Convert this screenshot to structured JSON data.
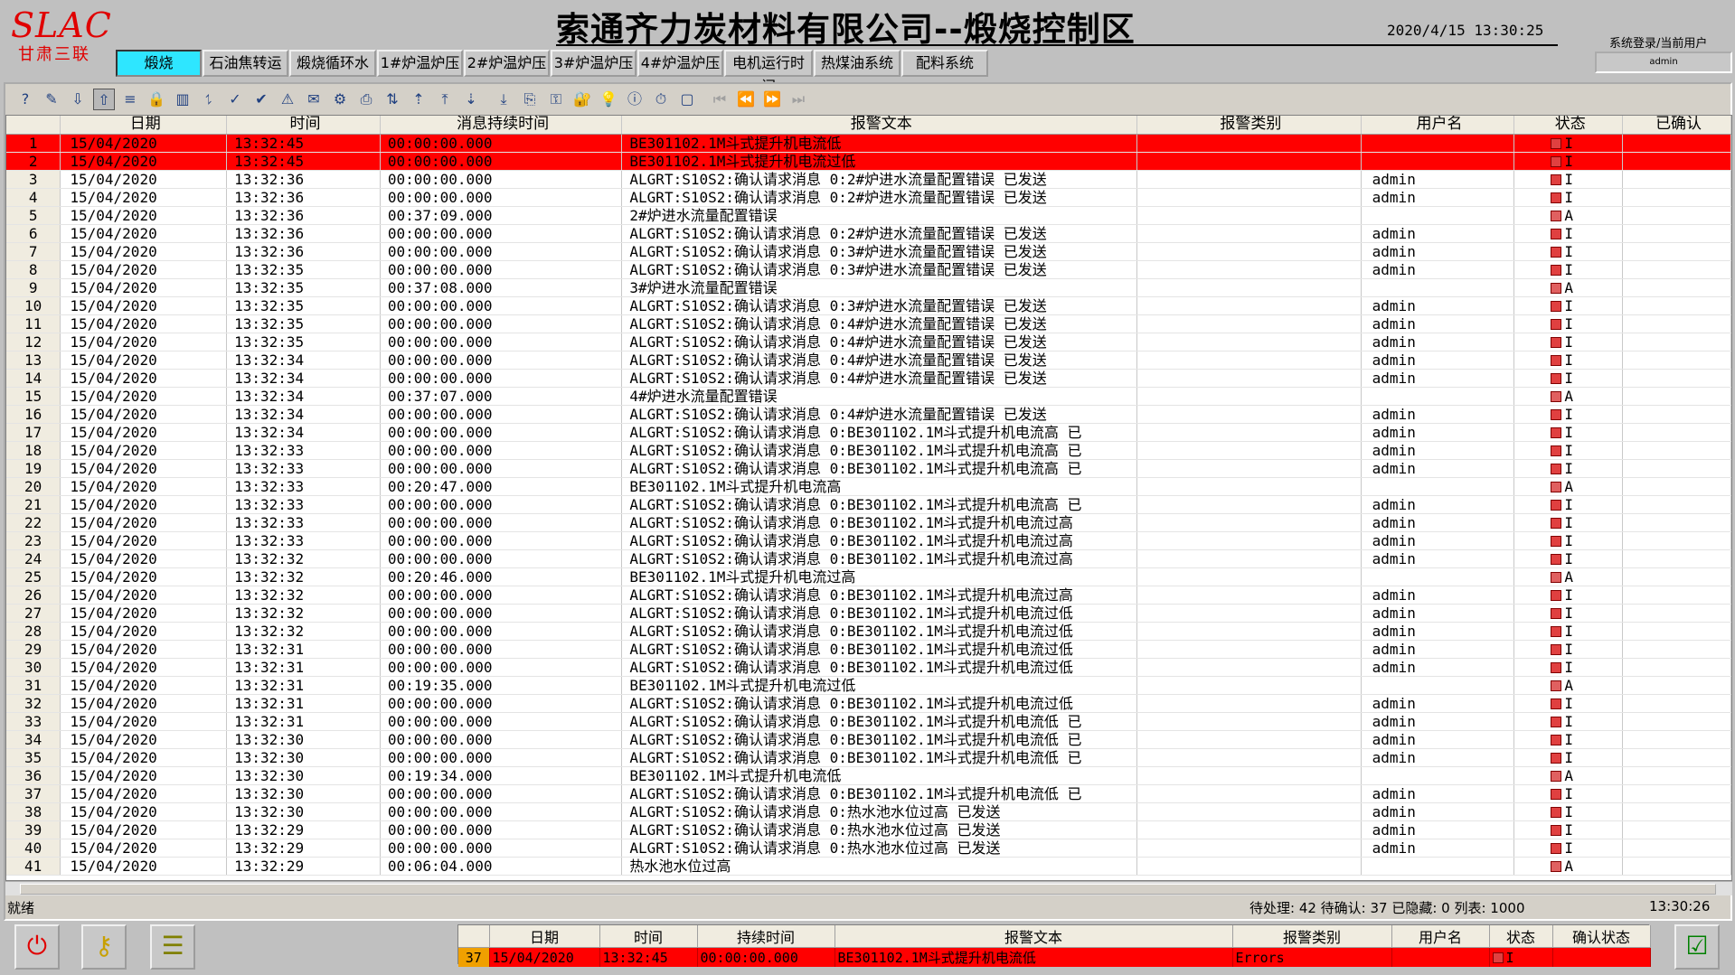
{
  "header": {
    "logo": "SLAC",
    "logo_sub": "甘肃三联",
    "title": "索通齐力炭材料有限公司--煅烧控制区",
    "datetime": "2020/4/15 13:30:25",
    "login_label": "系统登录/当前用户",
    "login_user": "admin"
  },
  "nav": {
    "tabs": [
      "煅烧",
      "石油焦转运",
      "煅烧循环水",
      "1#炉温炉压",
      "2#炉温炉压",
      "3#炉温炉压",
      "4#炉温炉压",
      "电机运行时间",
      "热煤油系统",
      "配料系统"
    ],
    "active": "煅烧"
  },
  "toolbar": {
    "icons": [
      "help-icon",
      "edit-icon",
      "export-icon",
      "import-icon",
      "list-icon",
      "lock-icon",
      "chart-icon",
      "filter-icon",
      "ack-icon",
      "check-icon",
      "alarm-icon",
      "note-icon",
      "settings-icon",
      "print-icon",
      "sort-icon",
      "up-icon",
      "first-icon",
      "down-icon",
      "last-icon",
      "copy-icon",
      "key-icon",
      "padlock-icon",
      "bulb-icon",
      "info-icon",
      "clock-icon",
      "window-icon",
      "nav-first-icon",
      "nav-prev-icon",
      "nav-next-icon",
      "nav-last-icon"
    ]
  },
  "grid": {
    "columns": [
      "",
      "日期",
      "时间",
      "消息持续时间",
      "报警文本",
      "报警类别",
      "用户名",
      "状态",
      "已确认"
    ],
    "rows": [
      {
        "n": "1",
        "d": "15/04/2020",
        "t": "13:32:45",
        "dur": "00:00:00.000",
        "text": "BE301102.1M斗式提升机电流低",
        "cat": "",
        "user": "",
        "st": "I",
        "red": true
      },
      {
        "n": "2",
        "d": "15/04/2020",
        "t": "13:32:45",
        "dur": "00:00:00.000",
        "text": "BE301102.1M斗式提升机电流过低",
        "cat": "",
        "user": "",
        "st": "I",
        "red": true
      },
      {
        "n": "3",
        "d": "15/04/2020",
        "t": "13:32:36",
        "dur": "00:00:00.000",
        "text": "ALGRT:S10S2:确认请求消息 0:2#炉进水流量配置错误 已发送",
        "cat": "",
        "user": "admin",
        "st": "I"
      },
      {
        "n": "4",
        "d": "15/04/2020",
        "t": "13:32:36",
        "dur": "00:00:00.000",
        "text": "ALGRT:S10S2:确认请求消息 0:2#炉进水流量配置错误 已发送",
        "cat": "",
        "user": "admin",
        "st": "I"
      },
      {
        "n": "5",
        "d": "15/04/2020",
        "t": "13:32:36",
        "dur": "00:37:09.000",
        "text": "2#炉进水流量配置错误",
        "cat": "",
        "user": "",
        "st": "A"
      },
      {
        "n": "6",
        "d": "15/04/2020",
        "t": "13:32:36",
        "dur": "00:00:00.000",
        "text": "ALGRT:S10S2:确认请求消息 0:2#炉进水流量配置错误 已发送",
        "cat": "",
        "user": "admin",
        "st": "I"
      },
      {
        "n": "7",
        "d": "15/04/2020",
        "t": "13:32:36",
        "dur": "00:00:00.000",
        "text": "ALGRT:S10S2:确认请求消息 0:3#炉进水流量配置错误 已发送",
        "cat": "",
        "user": "admin",
        "st": "I"
      },
      {
        "n": "8",
        "d": "15/04/2020",
        "t": "13:32:35",
        "dur": "00:00:00.000",
        "text": "ALGRT:S10S2:确认请求消息 0:3#炉进水流量配置错误 已发送",
        "cat": "",
        "user": "admin",
        "st": "I"
      },
      {
        "n": "9",
        "d": "15/04/2020",
        "t": "13:32:35",
        "dur": "00:37:08.000",
        "text": "3#炉进水流量配置错误",
        "cat": "",
        "user": "",
        "st": "A"
      },
      {
        "n": "10",
        "d": "15/04/2020",
        "t": "13:32:35",
        "dur": "00:00:00.000",
        "text": "ALGRT:S10S2:确认请求消息 0:3#炉进水流量配置错误 已发送",
        "cat": "",
        "user": "admin",
        "st": "I"
      },
      {
        "n": "11",
        "d": "15/04/2020",
        "t": "13:32:35",
        "dur": "00:00:00.000",
        "text": "ALGRT:S10S2:确认请求消息 0:4#炉进水流量配置错误 已发送",
        "cat": "",
        "user": "admin",
        "st": "I"
      },
      {
        "n": "12",
        "d": "15/04/2020",
        "t": "13:32:35",
        "dur": "00:00:00.000",
        "text": "ALGRT:S10S2:确认请求消息 0:4#炉进水流量配置错误 已发送",
        "cat": "",
        "user": "admin",
        "st": "I"
      },
      {
        "n": "13",
        "d": "15/04/2020",
        "t": "13:32:34",
        "dur": "00:00:00.000",
        "text": "ALGRT:S10S2:确认请求消息 0:4#炉进水流量配置错误 已发送",
        "cat": "",
        "user": "admin",
        "st": "I"
      },
      {
        "n": "14",
        "d": "15/04/2020",
        "t": "13:32:34",
        "dur": "00:00:00.000",
        "text": "ALGRT:S10S2:确认请求消息 0:4#炉进水流量配置错误 已发送",
        "cat": "",
        "user": "admin",
        "st": "I"
      },
      {
        "n": "15",
        "d": "15/04/2020",
        "t": "13:32:34",
        "dur": "00:37:07.000",
        "text": "4#炉进水流量配置错误",
        "cat": "",
        "user": "",
        "st": "A"
      },
      {
        "n": "16",
        "d": "15/04/2020",
        "t": "13:32:34",
        "dur": "00:00:00.000",
        "text": "ALGRT:S10S2:确认请求消息 0:4#炉进水流量配置错误 已发送",
        "cat": "",
        "user": "admin",
        "st": "I"
      },
      {
        "n": "17",
        "d": "15/04/2020",
        "t": "13:32:34",
        "dur": "00:00:00.000",
        "text": "ALGRT:S10S2:确认请求消息 0:BE301102.1M斗式提升机电流高 已",
        "cat": "",
        "user": "admin",
        "st": "I"
      },
      {
        "n": "18",
        "d": "15/04/2020",
        "t": "13:32:33",
        "dur": "00:00:00.000",
        "text": "ALGRT:S10S2:确认请求消息 0:BE301102.1M斗式提升机电流高 已",
        "cat": "",
        "user": "admin",
        "st": "I"
      },
      {
        "n": "19",
        "d": "15/04/2020",
        "t": "13:32:33",
        "dur": "00:00:00.000",
        "text": "ALGRT:S10S2:确认请求消息 0:BE301102.1M斗式提升机电流高 已",
        "cat": "",
        "user": "admin",
        "st": "I"
      },
      {
        "n": "20",
        "d": "15/04/2020",
        "t": "13:32:33",
        "dur": "00:20:47.000",
        "text": "BE301102.1M斗式提升机电流高",
        "cat": "",
        "user": "",
        "st": "A"
      },
      {
        "n": "21",
        "d": "15/04/2020",
        "t": "13:32:33",
        "dur": "00:00:00.000",
        "text": "ALGRT:S10S2:确认请求消息 0:BE301102.1M斗式提升机电流高 已",
        "cat": "",
        "user": "admin",
        "st": "I"
      },
      {
        "n": "22",
        "d": "15/04/2020",
        "t": "13:32:33",
        "dur": "00:00:00.000",
        "text": "ALGRT:S10S2:确认请求消息 0:BE301102.1M斗式提升机电流过高",
        "cat": "",
        "user": "admin",
        "st": "I"
      },
      {
        "n": "23",
        "d": "15/04/2020",
        "t": "13:32:33",
        "dur": "00:00:00.000",
        "text": "ALGRT:S10S2:确认请求消息 0:BE301102.1M斗式提升机电流过高",
        "cat": "",
        "user": "admin",
        "st": "I"
      },
      {
        "n": "24",
        "d": "15/04/2020",
        "t": "13:32:32",
        "dur": "00:00:00.000",
        "text": "ALGRT:S10S2:确认请求消息 0:BE301102.1M斗式提升机电流过高",
        "cat": "",
        "user": "admin",
        "st": "I"
      },
      {
        "n": "25",
        "d": "15/04/2020",
        "t": "13:32:32",
        "dur": "00:20:46.000",
        "text": "BE301102.1M斗式提升机电流过高",
        "cat": "",
        "user": "",
        "st": "A"
      },
      {
        "n": "26",
        "d": "15/04/2020",
        "t": "13:32:32",
        "dur": "00:00:00.000",
        "text": "ALGRT:S10S2:确认请求消息 0:BE301102.1M斗式提升机电流过高",
        "cat": "",
        "user": "admin",
        "st": "I"
      },
      {
        "n": "27",
        "d": "15/04/2020",
        "t": "13:32:32",
        "dur": "00:00:00.000",
        "text": "ALGRT:S10S2:确认请求消息 0:BE301102.1M斗式提升机电流过低",
        "cat": "",
        "user": "admin",
        "st": "I"
      },
      {
        "n": "28",
        "d": "15/04/2020",
        "t": "13:32:32",
        "dur": "00:00:00.000",
        "text": "ALGRT:S10S2:确认请求消息 0:BE301102.1M斗式提升机电流过低",
        "cat": "",
        "user": "admin",
        "st": "I"
      },
      {
        "n": "29",
        "d": "15/04/2020",
        "t": "13:32:31",
        "dur": "00:00:00.000",
        "text": "ALGRT:S10S2:确认请求消息 0:BE301102.1M斗式提升机电流过低",
        "cat": "",
        "user": "admin",
        "st": "I"
      },
      {
        "n": "30",
        "d": "15/04/2020",
        "t": "13:32:31",
        "dur": "00:00:00.000",
        "text": "ALGRT:S10S2:确认请求消息 0:BE301102.1M斗式提升机电流过低",
        "cat": "",
        "user": "admin",
        "st": "I"
      },
      {
        "n": "31",
        "d": "15/04/2020",
        "t": "13:32:31",
        "dur": "00:19:35.000",
        "text": "BE301102.1M斗式提升机电流过低",
        "cat": "",
        "user": "",
        "st": "A"
      },
      {
        "n": "32",
        "d": "15/04/2020",
        "t": "13:32:31",
        "dur": "00:00:00.000",
        "text": "ALGRT:S10S2:确认请求消息 0:BE301102.1M斗式提升机电流过低",
        "cat": "",
        "user": "admin",
        "st": "I"
      },
      {
        "n": "33",
        "d": "15/04/2020",
        "t": "13:32:31",
        "dur": "00:00:00.000",
        "text": "ALGRT:S10S2:确认请求消息 0:BE301102.1M斗式提升机电流低 已",
        "cat": "",
        "user": "admin",
        "st": "I"
      },
      {
        "n": "34",
        "d": "15/04/2020",
        "t": "13:32:30",
        "dur": "00:00:00.000",
        "text": "ALGRT:S10S2:确认请求消息 0:BE301102.1M斗式提升机电流低 已",
        "cat": "",
        "user": "admin",
        "st": "I"
      },
      {
        "n": "35",
        "d": "15/04/2020",
        "t": "13:32:30",
        "dur": "00:00:00.000",
        "text": "ALGRT:S10S2:确认请求消息 0:BE301102.1M斗式提升机电流低 已",
        "cat": "",
        "user": "admin",
        "st": "I"
      },
      {
        "n": "36",
        "d": "15/04/2020",
        "t": "13:32:30",
        "dur": "00:19:34.000",
        "text": "BE301102.1M斗式提升机电流低",
        "cat": "",
        "user": "",
        "st": "A"
      },
      {
        "n": "37",
        "d": "15/04/2020",
        "t": "13:32:30",
        "dur": "00:00:00.000",
        "text": "ALGRT:S10S2:确认请求消息 0:BE301102.1M斗式提升机电流低 已",
        "cat": "",
        "user": "admin",
        "st": "I"
      },
      {
        "n": "38",
        "d": "15/04/2020",
        "t": "13:32:30",
        "dur": "00:00:00.000",
        "text": "ALGRT:S10S2:确认请求消息 0:热水池水位过高 已发送",
        "cat": "",
        "user": "admin",
        "st": "I"
      },
      {
        "n": "39",
        "d": "15/04/2020",
        "t": "13:32:29",
        "dur": "00:00:00.000",
        "text": "ALGRT:S10S2:确认请求消息 0:热水池水位过高 已发送",
        "cat": "",
        "user": "admin",
        "st": "I"
      },
      {
        "n": "40",
        "d": "15/04/2020",
        "t": "13:32:29",
        "dur": "00:00:00.000",
        "text": "ALGRT:S10S2:确认请求消息 0:热水池水位过高 已发送",
        "cat": "",
        "user": "admin",
        "st": "I"
      },
      {
        "n": "41",
        "d": "15/04/2020",
        "t": "13:32:29",
        "dur": "00:06:04.000",
        "text": "热水池水位过高",
        "cat": "",
        "user": "",
        "st": "A"
      }
    ]
  },
  "status": {
    "left": "就绪",
    "counts": "待处理: 42 待确认: 37 已隐藏: 0 列表: 1000",
    "time": "13:30:26"
  },
  "mini": {
    "columns": [
      "",
      "日期",
      "时间",
      "持续时间",
      "报警文本",
      "报警类别",
      "用户名",
      "状态",
      "确认状态"
    ],
    "row": {
      "n": "37",
      "d": "15/04/2020",
      "t": "13:32:45",
      "dur": "00:00:00.000",
      "text": "BE301102.1M斗式提升机电流低",
      "cat": "Errors",
      "user": "",
      "st": "I",
      "ack": ""
    }
  },
  "colors": {
    "active_tab": "#2ee6ff",
    "alarm_red": "#ff0000",
    "selected_index": "#f0a000"
  }
}
